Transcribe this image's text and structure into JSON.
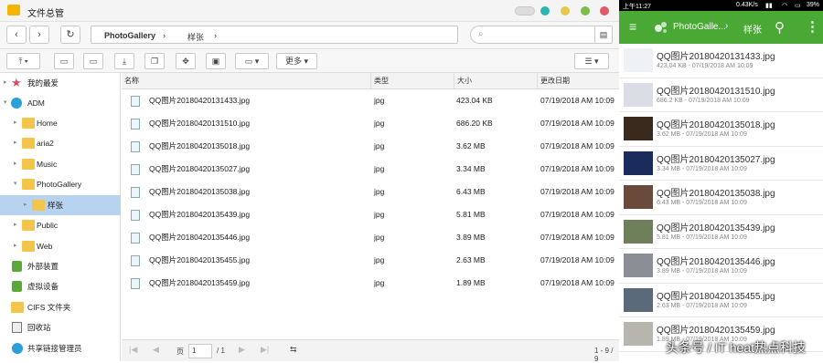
{
  "window": {
    "title": "文件总管"
  },
  "nav": {
    "back_icon": "chevron-left-icon",
    "forward_icon": "chevron-right-icon",
    "refresh_icon": "refresh-icon",
    "path": [
      "PhotoGallery",
      "样张"
    ],
    "sep": "›"
  },
  "toolbar": {
    "more_label": "更多"
  },
  "sidebar": {
    "items": [
      {
        "label": "我的最爱",
        "icon": "star-icon"
      },
      {
        "label": "ADM",
        "icon": "adm-icon"
      },
      {
        "label": "Home",
        "icon": "folder-icon"
      },
      {
        "label": "aria2",
        "icon": "folder-icon"
      },
      {
        "label": "Music",
        "icon": "folder-icon"
      },
      {
        "label": "PhotoGallery",
        "icon": "folder-icon"
      },
      {
        "label": "样张",
        "icon": "folder-icon"
      },
      {
        "label": "Public",
        "icon": "folder-icon"
      },
      {
        "label": "Web",
        "icon": "folder-icon"
      },
      {
        "label": "外部装置",
        "icon": "usb-icon"
      },
      {
        "label": "虚拟设备",
        "icon": "virtual-device-icon"
      },
      {
        "label": "CIFS 文件夹",
        "icon": "folder-icon"
      },
      {
        "label": "回收站",
        "icon": "recycle-bin-icon"
      },
      {
        "label": "共享链接管理员",
        "icon": "share-icon"
      }
    ]
  },
  "table": {
    "headers": [
      "名称",
      "类型",
      "大小",
      "更改日期"
    ],
    "rows": [
      {
        "name": "QQ图片20180420131433.jpg",
        "type": "jpg",
        "size": "423.04 KB",
        "date": "07/19/2018 AM 10:09"
      },
      {
        "name": "QQ图片20180420131510.jpg",
        "type": "jpg",
        "size": "686.20 KB",
        "date": "07/19/2018 AM 10:09"
      },
      {
        "name": "QQ图片20180420135018.jpg",
        "type": "jpg",
        "size": "3.62 MB",
        "date": "07/19/2018 AM 10:09"
      },
      {
        "name": "QQ图片20180420135027.jpg",
        "type": "jpg",
        "size": "3.34 MB",
        "date": "07/19/2018 AM 10:09"
      },
      {
        "name": "QQ图片20180420135038.jpg",
        "type": "jpg",
        "size": "6.43 MB",
        "date": "07/19/2018 AM 10:09"
      },
      {
        "name": "QQ图片20180420135439.jpg",
        "type": "jpg",
        "size": "5.81 MB",
        "date": "07/19/2018 AM 10:09"
      },
      {
        "name": "QQ图片20180420135446.jpg",
        "type": "jpg",
        "size": "3.89 MB",
        "date": "07/19/2018 AM 10:09"
      },
      {
        "name": "QQ图片20180420135455.jpg",
        "type": "jpg",
        "size": "2.63 MB",
        "date": "07/19/2018 AM 10:09"
      },
      {
        "name": "QQ图片20180420135459.jpg",
        "type": "jpg",
        "size": "1.89 MB",
        "date": "07/19/2018 AM 10:09"
      }
    ]
  },
  "pager": {
    "page_label": "页",
    "page_value": "1",
    "total": "/ 1",
    "count": "1 - 9 / 9"
  },
  "phone": {
    "status": {
      "time": "上午11:27",
      "net": "0.43K/s",
      "battery": "39%"
    },
    "appbar": {
      "path1": "PhotoGalle...",
      "sep": "›",
      "path2": "样张"
    },
    "items": [
      {
        "name": "QQ图片20180420131433.jpg",
        "sub": "423.04 KB - 07/19/2018 AM 10:09",
        "thumb": "#eef1f5"
      },
      {
        "name": "QQ图片20180420131510.jpg",
        "sub": "686.2 KB - 07/19/2018 AM 10:09",
        "thumb": "#d9dde4"
      },
      {
        "name": "QQ图片20180420135018.jpg",
        "sub": "3.62 MB - 07/19/2018 AM 10:09",
        "thumb": "#3a2a1e"
      },
      {
        "name": "QQ图片20180420135027.jpg",
        "sub": "3.34 MB - 07/19/2018 AM 10:09",
        "thumb": "#1b2b5c"
      },
      {
        "name": "QQ图片20180420135038.jpg",
        "sub": "6.43 MB - 07/19/2018 AM 10:09",
        "thumb": "#6a4a3a"
      },
      {
        "name": "QQ图片20180420135439.jpg",
        "sub": "5.81 MB - 07/19/2018 AM 10:09",
        "thumb": "#6f7f5a"
      },
      {
        "name": "QQ图片20180420135446.jpg",
        "sub": "3.89 MB - 07/19/2018 AM 10:09",
        "thumb": "#8a8f96"
      },
      {
        "name": "QQ图片20180420135455.jpg",
        "sub": "2.63 MB - 07/19/2018 AM 10:09",
        "thumb": "#5a6a7a"
      },
      {
        "name": "QQ图片20180420135459.jpg",
        "sub": "1.89 MB - 07/19/2018 AM 10:09",
        "thumb": "#b8b4ae"
      }
    ]
  },
  "watermark": "头条号 / IT heat热点科技",
  "colors": {
    "accent_green": "#49a934",
    "selection": "#b7d3f0",
    "folder": "#f3c64b"
  }
}
